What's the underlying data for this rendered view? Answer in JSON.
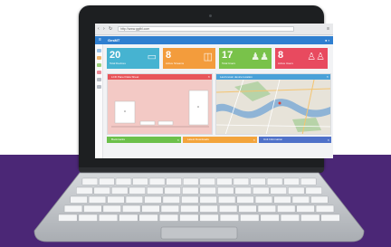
{
  "browser": {
    "url": "http://www.ggtbl.com",
    "bookmark": "Apps",
    "back_icon": "arrow-left-icon",
    "forward_icon": "arrow-right-icon",
    "reload_icon": "reload-icon",
    "menu_icon": "menu-dots-icon"
  },
  "app": {
    "brand": "GesMT",
    "header_color": "#2f7fd0"
  },
  "tiles": [
    {
      "value": "20",
      "label": "Total Devices",
      "color": "#46b3d1",
      "icon": "tablet-icon"
    },
    {
      "value": "8",
      "label": "Active Streams",
      "color": "#f39c3c",
      "icon": "cast-icon"
    },
    {
      "value": "17",
      "label": "Total Users",
      "color": "#79c24a",
      "icon": "users-icon"
    },
    {
      "value": "8",
      "label": "Active Users",
      "color": "#e84a5f",
      "icon": "user-group-icon"
    }
  ],
  "panels": {
    "left_title": "LCD Panel Data Sheet",
    "left_color": "#e8555a",
    "right_title": "Last known device location",
    "right_color": "#4aa1d8"
  },
  "bottom_bars": [
    {
      "label": "Bookmarks",
      "color": "#6cc04a"
    },
    {
      "label": "Latest Downloads",
      "color": "#f3a43c"
    },
    {
      "label": "Unit Information",
      "color": "#4f71c9"
    }
  ],
  "colors": {
    "background_band": "#4b2776",
    "laptop_body": "#1d1f21",
    "keyboard_deck": "#c9ccd0"
  }
}
